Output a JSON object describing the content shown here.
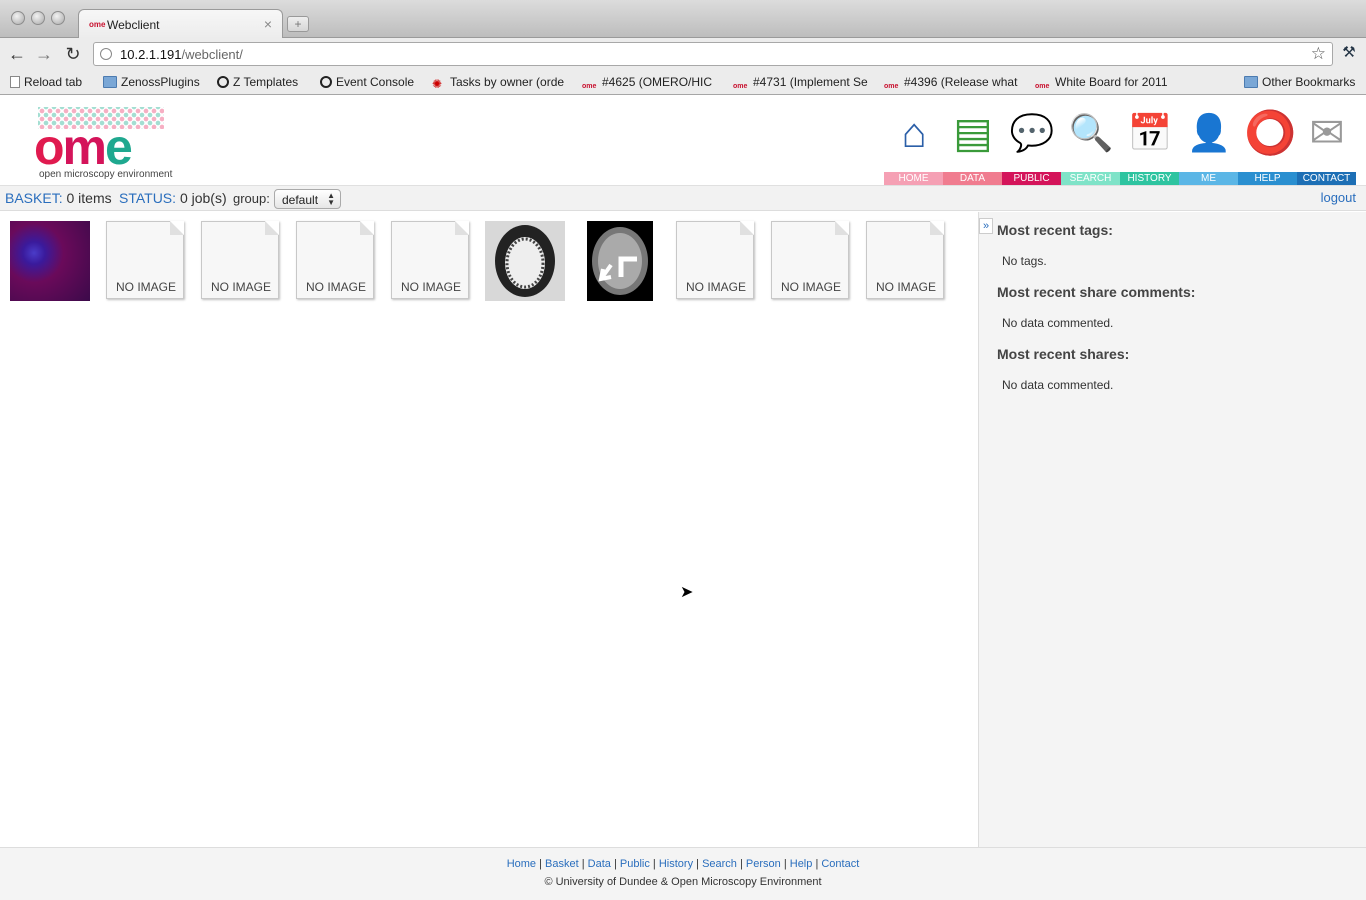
{
  "browser": {
    "tab_title": "Webclient",
    "tab_close": "×",
    "new_tab": "+",
    "url_host": "10.2.1.191",
    "url_path": "/webclient/"
  },
  "bookmarks": [
    {
      "label": "Reload tab",
      "icon": "page-icon"
    },
    {
      "label": "ZenossPlugins",
      "icon": "folder-icon"
    },
    {
      "label": "Z Templates",
      "icon": "zenoss-icon"
    },
    {
      "label": "Event Console",
      "icon": "zenoss-icon"
    },
    {
      "label": "Tasks by owner (orde",
      "icon": "redmine-icon"
    },
    {
      "label": "#4625 (OMERO/HIC",
      "icon": "ome-icon"
    },
    {
      "label": "#4731 (Implement Se",
      "icon": "ome-icon"
    },
    {
      "label": "#4396 (Release what",
      "icon": "ome-icon"
    },
    {
      "label": "White Board for 2011",
      "icon": "ome-icon"
    },
    {
      "label": "Other Bookmarks",
      "icon": "folder-icon"
    }
  ],
  "logo": {
    "o1": "o",
    "m": "m",
    "e": "e",
    "subtitle": "open microscopy environment"
  },
  "nav": [
    {
      "label": "HOME",
      "color": "#f5a0b4",
      "glyph": "⌂"
    },
    {
      "label": "DATA",
      "color": "#f07c8f",
      "glyph": "▤"
    },
    {
      "label": "PUBLIC",
      "color": "#d4145a",
      "glyph": "💬"
    },
    {
      "label": "SEARCH",
      "color": "#7fe3c8",
      "glyph": "🔍"
    },
    {
      "label": "HISTORY",
      "color": "#2ec4a0",
      "glyph": "📅"
    },
    {
      "label": "ME",
      "color": "#5bb6e6",
      "glyph": "👤"
    },
    {
      "label": "HELP",
      "color": "#2a8fd0",
      "glyph": "⭕"
    },
    {
      "label": "CONTACT",
      "color": "#1d6fb5",
      "glyph": "✉"
    }
  ],
  "status": {
    "basket_key": "BASKET:",
    "basket_val": "0 items",
    "status_key": "STATUS:",
    "status_val": "0 job(s)",
    "group_label": "group:",
    "group_value": "default",
    "logout": "logout"
  },
  "thumbnails": [
    {
      "type": "image",
      "kind": "purple"
    },
    {
      "type": "noimage",
      "text": "NO IMAGE"
    },
    {
      "type": "noimage",
      "text": "NO IMAGE"
    },
    {
      "type": "noimage",
      "text": "NO IMAGE"
    },
    {
      "type": "noimage",
      "text": "NO IMAGE"
    },
    {
      "type": "image",
      "kind": "cell"
    },
    {
      "type": "image",
      "kind": "brain"
    },
    {
      "type": "noimage",
      "text": "NO IMAGE"
    },
    {
      "type": "noimage",
      "text": "NO IMAGE"
    },
    {
      "type": "noimage",
      "text": "NO IMAGE"
    }
  ],
  "sidebar": {
    "toggle": "»",
    "tags_title": "Most recent tags:",
    "tags_body": "No tags.",
    "comments_title": "Most recent share comments:",
    "comments_body": "No data commented.",
    "shares_title": "Most recent shares:",
    "shares_body": "No data commented."
  },
  "footer": {
    "links": [
      "Home",
      "Basket",
      "Data",
      "Public",
      "History",
      "Search",
      "Person",
      "Help",
      "Contact"
    ],
    "separator": "|",
    "copyright": "© University of Dundee & Open Microscopy Environment"
  }
}
